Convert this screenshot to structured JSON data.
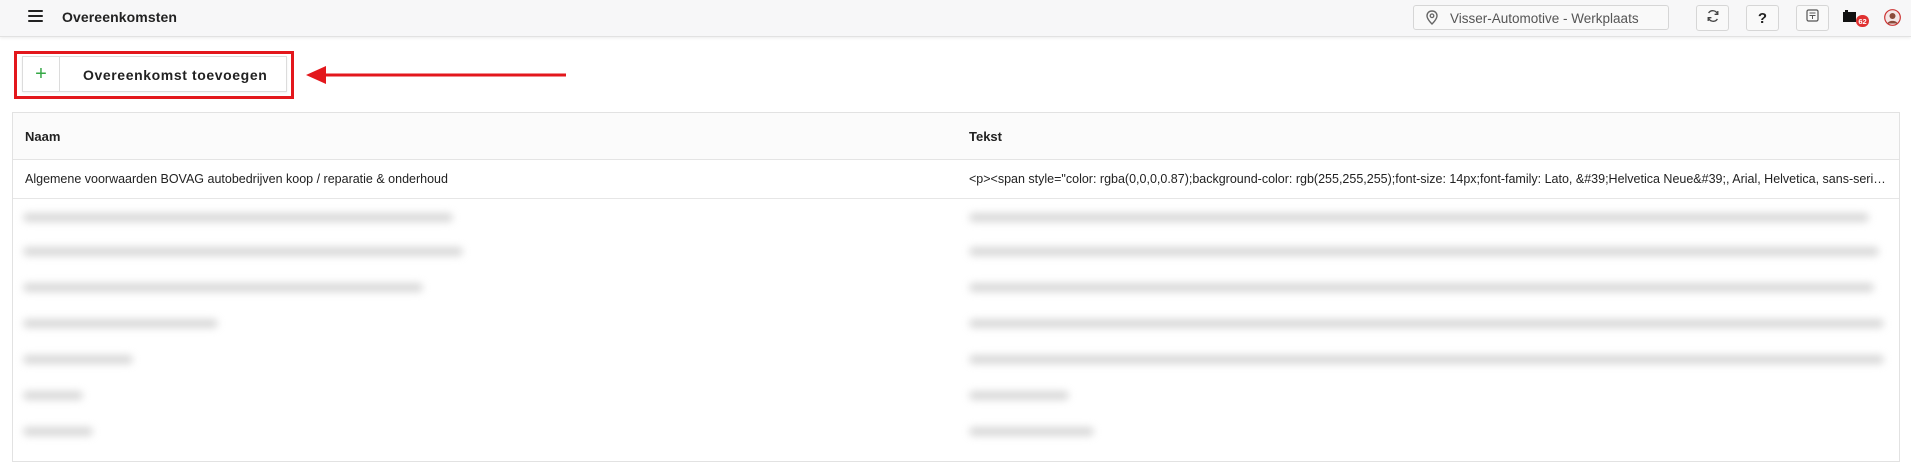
{
  "header": {
    "title": "Overeenkomsten",
    "location": "Visser-Automotive - Werkplaats",
    "help_label": "?",
    "notification_count": "62"
  },
  "toolbar": {
    "add_button_label": "Overeenkomst toevoegen",
    "add_icon": "+"
  },
  "table": {
    "columns": [
      "Naam",
      "Tekst"
    ],
    "rows": [
      {
        "naam": "Algemene voorwaarden BOVAG autobedrijven koop / reparatie & onderhoud",
        "tekst": "<p><span style=\"color: rgba(0,0,0,0.87);background-color: rgb(255,255,255);font-size: 14px;font-family: Lato, &#39;Helvetica Neue&#39;, Arial, Helvetica, sans-serif;…"
      }
    ]
  },
  "colors": {
    "highlight": "#e3171c",
    "badge": "#e03131",
    "plus": "#35a846"
  }
}
